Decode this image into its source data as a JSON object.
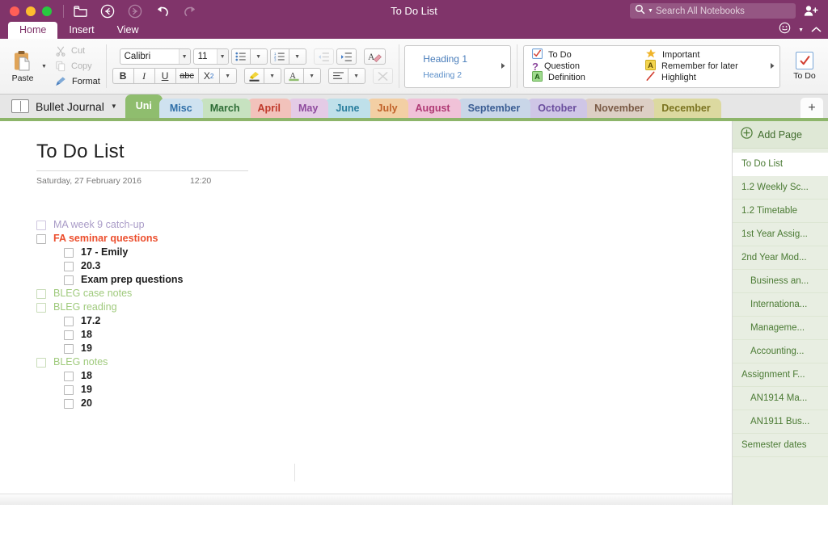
{
  "window": {
    "title": "To Do List",
    "traffic_lights": [
      "close",
      "minimize",
      "maximize"
    ],
    "nav_icons": [
      "folder-icon",
      "back-icon",
      "forward-icon",
      "undo-icon",
      "redo-icon"
    ]
  },
  "search": {
    "placeholder": "Search All Notebooks",
    "value": "",
    "icon": "search-icon"
  },
  "ribbon": {
    "tabs": [
      {
        "label": "Home",
        "active": true
      },
      {
        "label": "Insert",
        "active": false
      },
      {
        "label": "View",
        "active": false
      }
    ],
    "clipboard": {
      "paste_label": "Paste",
      "cut_label": "Cut",
      "copy_label": "Copy",
      "format_label": "Format"
    },
    "font": {
      "family": "Calibri",
      "size": "11",
      "bold": "B",
      "italic": "I",
      "underline": "U",
      "strikethrough": "abc",
      "subscript": "X",
      "subscript_sub": "2"
    },
    "styles": {
      "heading1": "Heading 1",
      "heading2": "Heading 2"
    },
    "tags": {
      "column1": [
        {
          "label": "To Do",
          "icon": "checkbox-check-icon"
        },
        {
          "label": "Question",
          "icon": "question-mark-icon"
        },
        {
          "label": "Definition",
          "icon": "letter-a-green-icon"
        }
      ],
      "column2": [
        {
          "label": "Important",
          "icon": "star-icon"
        },
        {
          "label": "Remember for later",
          "icon": "letter-a-yellow-icon"
        },
        {
          "label": "Highlight",
          "icon": "pen-icon"
        }
      ]
    },
    "todo_button": {
      "label": "To Do",
      "icon": "checkbox-check-icon"
    }
  },
  "notebook": {
    "name": "Bullet Journal",
    "icon": "notebook-icon",
    "caret": "▼"
  },
  "sections": [
    {
      "label": "Uni",
      "active": true,
      "bg": "#8fbd6e",
      "fg": "#ffffff"
    },
    {
      "label": "Misc",
      "active": false,
      "bg": "#cfe2f0",
      "fg": "#2f6fa8"
    },
    {
      "label": "March",
      "active": false,
      "bg": "#c7e2c0",
      "fg": "#2c6b34"
    },
    {
      "label": "April",
      "active": false,
      "bg": "#f2c2bb",
      "fg": "#c0392b"
    },
    {
      "label": "May",
      "active": false,
      "bg": "#e4cbe6",
      "fg": "#8e4a9e"
    },
    {
      "label": "June",
      "active": false,
      "bg": "#bfe0ea",
      "fg": "#2a7f9e"
    },
    {
      "label": "July",
      "active": false,
      "bg": "#f3cfa4",
      "fg": "#c1622a"
    },
    {
      "label": "August",
      "active": false,
      "bg": "#f0c2d8",
      "fg": "#b03a75"
    },
    {
      "label": "September",
      "active": false,
      "bg": "#c9d6e8",
      "fg": "#3a5d93"
    },
    {
      "label": "October",
      "active": false,
      "bg": "#cfc6e6",
      "fg": "#6a4d9e"
    },
    {
      "label": "November",
      "active": false,
      "bg": "#ddcfc5",
      "fg": "#7a5a45"
    },
    {
      "label": "December",
      "active": false,
      "bg": "#dcd9a0",
      "fg": "#7a7320"
    }
  ],
  "add_section_label": "+",
  "page": {
    "title": "To Do List",
    "date": "Saturday, 27 February 2016",
    "time": "12:20",
    "items": [
      {
        "text": "MA week 9 catch-up",
        "color": "purple",
        "level": 0,
        "checked": false
      },
      {
        "text": "FA seminar questions",
        "color": "red",
        "level": 0,
        "checked": false
      },
      {
        "text": "17 - Emily",
        "color": "black",
        "level": 1,
        "checked": false
      },
      {
        "text": "20.3",
        "color": "black",
        "level": 1,
        "checked": false
      },
      {
        "text": "Exam prep questions",
        "color": "black",
        "level": 1,
        "checked": false
      },
      {
        "text": "BLEG case notes",
        "color": "green",
        "level": 0,
        "checked": false
      },
      {
        "text": "BLEG reading",
        "color": "green",
        "level": 0,
        "checked": false
      },
      {
        "text": "17.2",
        "color": "black",
        "level": 1,
        "checked": false
      },
      {
        "text": "18",
        "color": "black",
        "level": 1,
        "checked": false
      },
      {
        "text": "19",
        "color": "black",
        "level": 1,
        "checked": false
      },
      {
        "text": "BLEG notes",
        "color": "green",
        "level": 0,
        "checked": false
      },
      {
        "text": "18",
        "color": "black",
        "level": 1,
        "checked": false
      },
      {
        "text": "19",
        "color": "black",
        "level": 1,
        "checked": false
      },
      {
        "text": "20",
        "color": "black",
        "level": 1,
        "checked": false
      }
    ]
  },
  "pages_panel": {
    "add_page_label": "Add Page",
    "add_page_icon": "plus-circle-icon",
    "items": [
      {
        "label": "To Do List",
        "indent": false,
        "selected": true
      },
      {
        "label": "1.2 Weekly Sc...",
        "indent": false,
        "selected": false
      },
      {
        "label": "1.2 Timetable",
        "indent": false,
        "selected": false
      },
      {
        "label": "1st Year Assig...",
        "indent": false,
        "selected": false
      },
      {
        "label": "2nd Year Mod...",
        "indent": false,
        "selected": false
      },
      {
        "label": "Business an...",
        "indent": true,
        "selected": false
      },
      {
        "label": "Internationa...",
        "indent": true,
        "selected": false
      },
      {
        "label": "Manageme...",
        "indent": true,
        "selected": false
      },
      {
        "label": "Accounting...",
        "indent": true,
        "selected": false
      },
      {
        "label": "Assignment F...",
        "indent": false,
        "selected": false
      },
      {
        "label": "AN1914 Ma...",
        "indent": true,
        "selected": false
      },
      {
        "label": "AN1911 Bus...",
        "indent": true,
        "selected": false
      },
      {
        "label": "Semester dates",
        "indent": false,
        "selected": false
      }
    ]
  },
  "colors": {
    "brand_purple": "#80346a",
    "section_green": "#8db56a",
    "pages_bg": "#e8eee2",
    "accent_red": "#ec4f2e"
  }
}
